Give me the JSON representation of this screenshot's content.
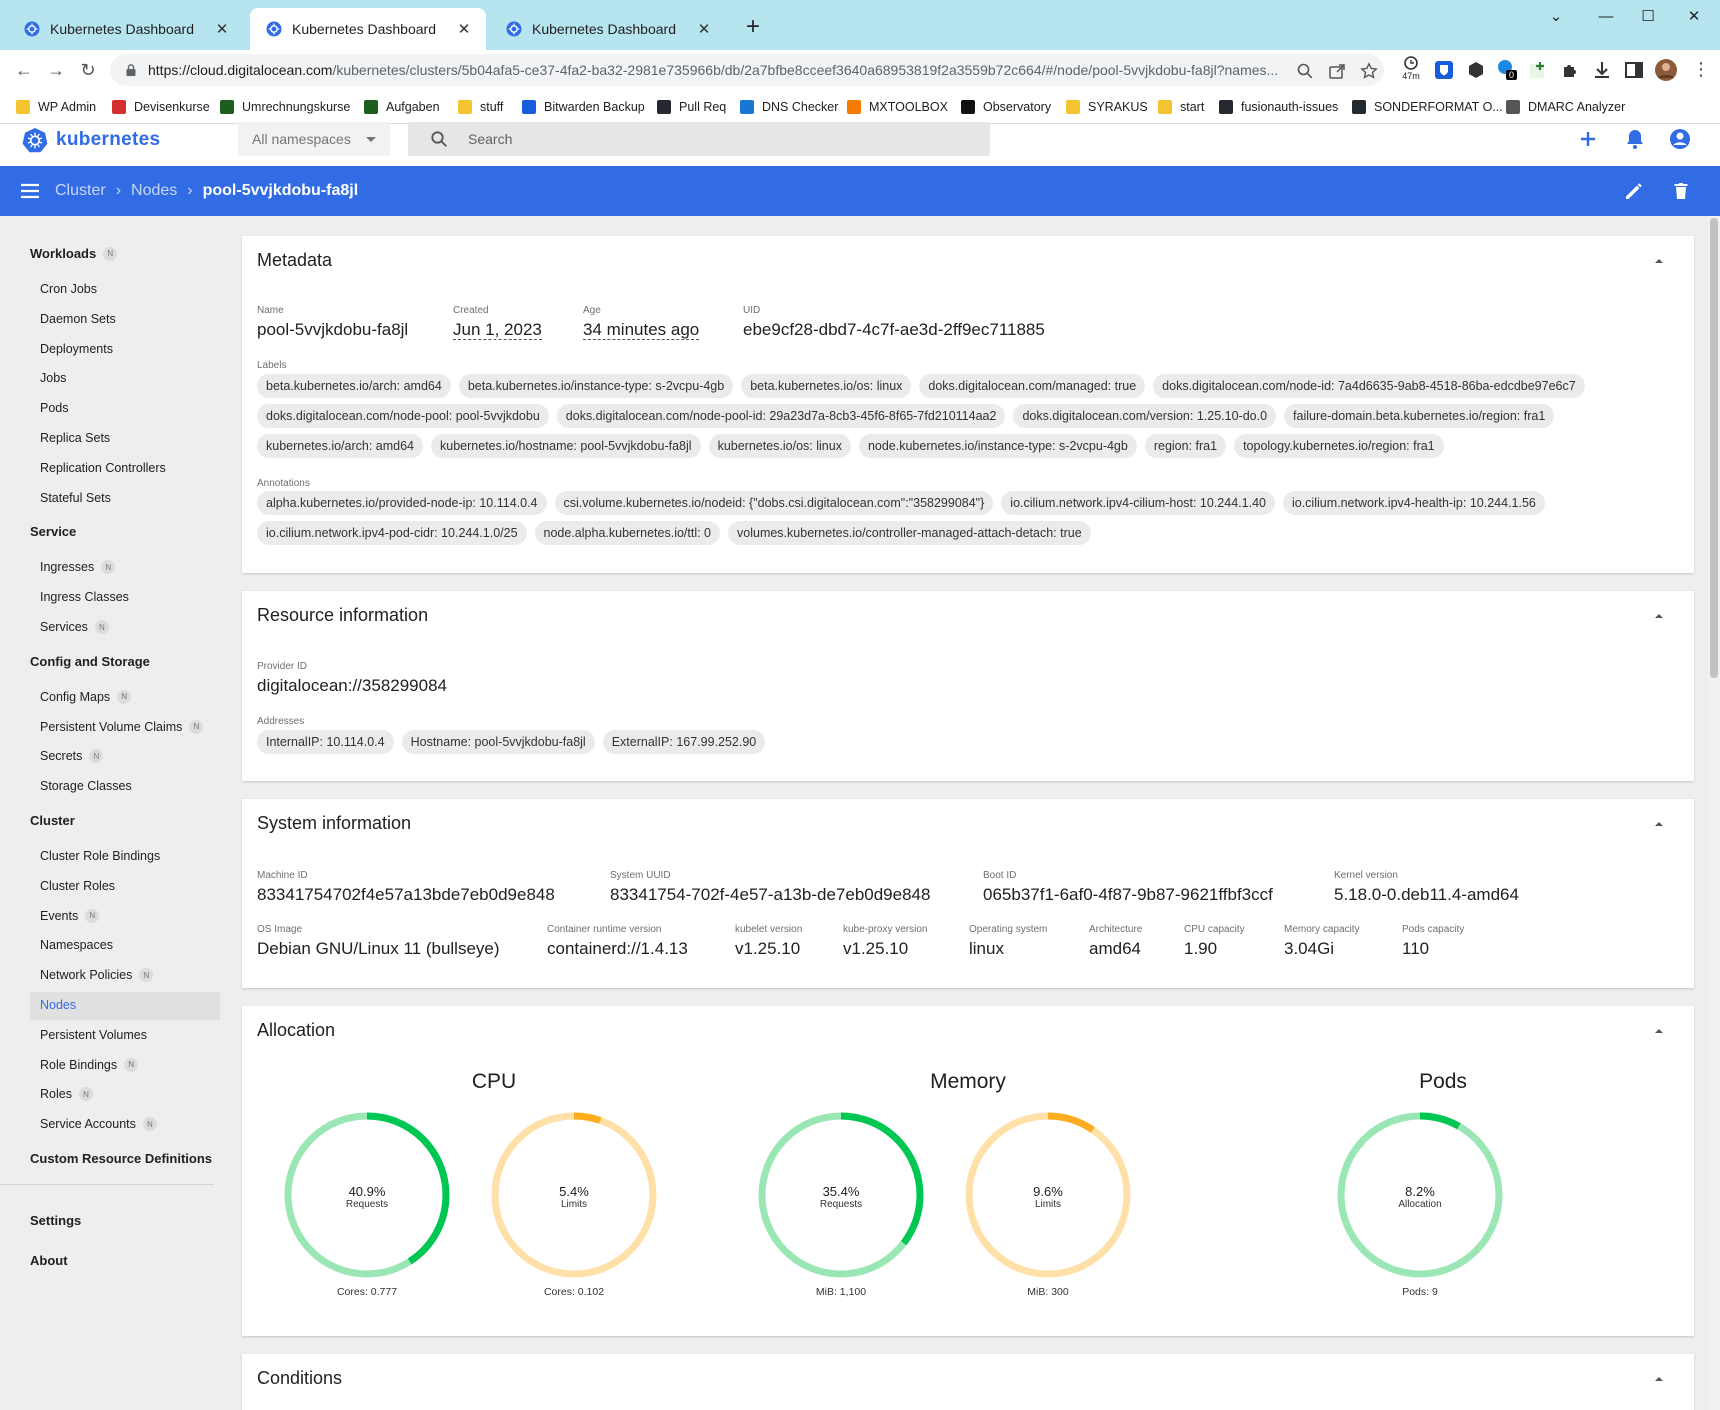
{
  "browser": {
    "tabs": [
      {
        "title": "Kubernetes Dashboard",
        "active": false
      },
      {
        "title": "Kubernetes Dashboard",
        "active": true
      },
      {
        "title": "Kubernetes Dashboard",
        "active": false
      }
    ],
    "url_host": "https://cloud.digitalocean.com",
    "url_path": "/kubernetes/clusters/5b04afa5-ce37-4fa2-ba32-2981e735966b/db/2a7bfbe8cceef3640a68953819f2a3559b72c664/#/node/pool-5vvjkdobu-fa8jl?names...",
    "extension_badge_time": "47m",
    "extension_badge_count": "0",
    "bookmarks": [
      {
        "label": "WP Admin",
        "color": "#f4c430"
      },
      {
        "label": "Devisenkurse",
        "color": "#d32f2f"
      },
      {
        "label": "Umrechnungskurse",
        "color": "#1b5e20"
      },
      {
        "label": "Aufgaben",
        "color": "#1b5e20"
      },
      {
        "label": "stuff",
        "color": "#f4c430"
      },
      {
        "label": "Bitwarden Backup",
        "color": "#175ddc"
      },
      {
        "label": "Pull Req",
        "color": "#24292f"
      },
      {
        "label": "DNS Checker",
        "color": "#1976d2"
      },
      {
        "label": "MXTOOLBOX",
        "color": "#f57c00"
      },
      {
        "label": "Observatory",
        "color": "#111111"
      },
      {
        "label": "SYRAKUS",
        "color": "#f4c430"
      },
      {
        "label": "start",
        "color": "#f4c430"
      },
      {
        "label": "fusionauth-issues",
        "color": "#24292f"
      },
      {
        "label": "SONDERFORMAT O...",
        "color": "#24292f"
      },
      {
        "label": "DMARC Analyzer",
        "color": "#555555"
      }
    ]
  },
  "app": {
    "logo_text": "kubernetes",
    "namespace_select": "All namespaces",
    "search_placeholder": "Search",
    "breadcrumbs": [
      "Cluster",
      "Nodes",
      "pool-5vvjkdobu-fa8jl"
    ]
  },
  "sidebar": {
    "sections": [
      {
        "label": "Workloads",
        "badge": "N",
        "items": [
          {
            "label": "Cron Jobs"
          },
          {
            "label": "Daemon Sets"
          },
          {
            "label": "Deployments"
          },
          {
            "label": "Jobs"
          },
          {
            "label": "Pods"
          },
          {
            "label": "Replica Sets"
          },
          {
            "label": "Replication Controllers"
          },
          {
            "label": "Stateful Sets"
          }
        ]
      },
      {
        "label": "Service",
        "items": [
          {
            "label": "Ingresses",
            "badge": "N"
          },
          {
            "label": "Ingress Classes"
          },
          {
            "label": "Services",
            "badge": "N"
          }
        ]
      },
      {
        "label": "Config and Storage",
        "items": [
          {
            "label": "Config Maps",
            "badge": "N"
          },
          {
            "label": "Persistent Volume Claims",
            "badge": "N"
          },
          {
            "label": "Secrets",
            "badge": "N"
          },
          {
            "label": "Storage Classes"
          }
        ]
      },
      {
        "label": "Cluster",
        "items": [
          {
            "label": "Cluster Role Bindings"
          },
          {
            "label": "Cluster Roles"
          },
          {
            "label": "Events",
            "badge": "N"
          },
          {
            "label": "Namespaces"
          },
          {
            "label": "Network Policies",
            "badge": "N"
          },
          {
            "label": "Nodes",
            "active": true
          },
          {
            "label": "Persistent Volumes"
          },
          {
            "label": "Role Bindings",
            "badge": "N"
          },
          {
            "label": "Roles",
            "badge": "N"
          },
          {
            "label": "Service Accounts",
            "badge": "N"
          }
        ]
      },
      {
        "label": "Custom Resource Definitions",
        "items": []
      }
    ],
    "settings": "Settings",
    "about": "About"
  },
  "metadata": {
    "title": "Metadata",
    "name_label": "Name",
    "name": "pool-5vvjkdobu-fa8jl",
    "created_label": "Created",
    "created": "Jun 1, 2023",
    "age_label": "Age",
    "age": "34 minutes ago",
    "uid_label": "UID",
    "uid": "ebe9cf28-dbd7-4c7f-ae3d-2ff9ec711885",
    "labels_label": "Labels",
    "labels": [
      "beta.kubernetes.io/arch: amd64",
      "beta.kubernetes.io/instance-type: s-2vcpu-4gb",
      "beta.kubernetes.io/os: linux",
      "doks.digitalocean.com/managed: true",
      "doks.digitalocean.com/node-id: 7a4d6635-9ab8-4518-86ba-edcdbe97e6c7",
      "doks.digitalocean.com/node-pool: pool-5vvjkdobu",
      "doks.digitalocean.com/node-pool-id: 29a23d7a-8cb3-45f6-8f65-7fd210114aa2",
      "doks.digitalocean.com/version: 1.25.10-do.0",
      "failure-domain.beta.kubernetes.io/region: fra1",
      "kubernetes.io/arch: amd64",
      "kubernetes.io/hostname: pool-5vvjkdobu-fa8jl",
      "kubernetes.io/os: linux",
      "node.kubernetes.io/instance-type: s-2vcpu-4gb",
      "region: fra1",
      "topology.kubernetes.io/region: fra1"
    ],
    "annotations_label": "Annotations",
    "annotations": [
      "alpha.kubernetes.io/provided-node-ip: 10.114.0.4",
      "csi.volume.kubernetes.io/nodeid: {\"dobs.csi.digitalocean.com\":\"358299084\"}",
      "io.cilium.network.ipv4-cilium-host: 10.244.1.40",
      "io.cilium.network.ipv4-health-ip: 10.244.1.56",
      "io.cilium.network.ipv4-pod-cidr: 10.244.1.0/25",
      "node.alpha.kubernetes.io/ttl: 0",
      "volumes.kubernetes.io/controller-managed-attach-detach: true"
    ]
  },
  "resource": {
    "title": "Resource information",
    "provider_label": "Provider ID",
    "provider": "digitalocean://358299084",
    "addresses_label": "Addresses",
    "addresses": [
      "InternalIP: 10.114.0.4",
      "Hostname: pool-5vvjkdobu-fa8jl",
      "ExternalIP: 167.99.252.90"
    ]
  },
  "system": {
    "title": "System information",
    "machine_label": "Machine ID",
    "machine": "83341754702f4e57a13bde7eb0d9e848",
    "uuid_label": "System UUID",
    "uuid": "83341754-702f-4e57-a13b-de7eb0d9e848",
    "boot_label": "Boot ID",
    "boot": "065b37f1-6af0-4f87-9b87-9621ffbf3ccf",
    "kernel_label": "Kernel version",
    "kernel": "5.18.0-0.deb11.4-amd64",
    "os_image_label": "OS Image",
    "os_image": "Debian GNU/Linux 11 (bullseye)",
    "runtime_label": "Container runtime version",
    "runtime": "containerd://1.4.13",
    "kubelet_label": "kubelet version",
    "kubelet": "v1.25.10",
    "proxy_label": "kube-proxy version",
    "proxy": "v1.25.10",
    "os_label": "Operating system",
    "os": "linux",
    "arch_label": "Architecture",
    "arch": "amd64",
    "cpu_label": "CPU capacity",
    "cpu": "1.90",
    "mem_label": "Memory capacity",
    "mem": "3.04Gi",
    "pods_label": "Pods capacity",
    "pods": "110"
  },
  "allocation": {
    "title": "Allocation",
    "groups": [
      {
        "title": "CPU",
        "charts": [
          {
            "percent": 40.9,
            "pct_text": "40.9%",
            "label": "Requests",
            "footer": "Cores: 0.777",
            "color": "#00c752",
            "track": "#9ae6b4"
          },
          {
            "percent": 5.4,
            "pct_text": "5.4%",
            "label": "Limits",
            "footer": "Cores: 0.102",
            "color": "#ffad20",
            "track": "#ffe0a8"
          }
        ]
      },
      {
        "title": "Memory",
        "charts": [
          {
            "percent": 35.4,
            "pct_text": "35.4%",
            "label": "Requests",
            "footer": "MiB: 1,100",
            "color": "#00c752",
            "track": "#9ae6b4"
          },
          {
            "percent": 9.6,
            "pct_text": "9.6%",
            "label": "Limits",
            "footer": "MiB: 300",
            "color": "#ffad20",
            "track": "#ffe0a8"
          }
        ]
      },
      {
        "title": "Pods",
        "charts": [
          {
            "percent": 8.2,
            "pct_text": "8.2%",
            "label": "Allocation",
            "footer": "Pods: 9",
            "color": "#00c752",
            "track": "#9ae6b4"
          }
        ]
      }
    ]
  },
  "conditions": {
    "title": "Conditions"
  },
  "colors": {
    "brand": "#326ce5",
    "tabbar": "#b6e4ef"
  }
}
